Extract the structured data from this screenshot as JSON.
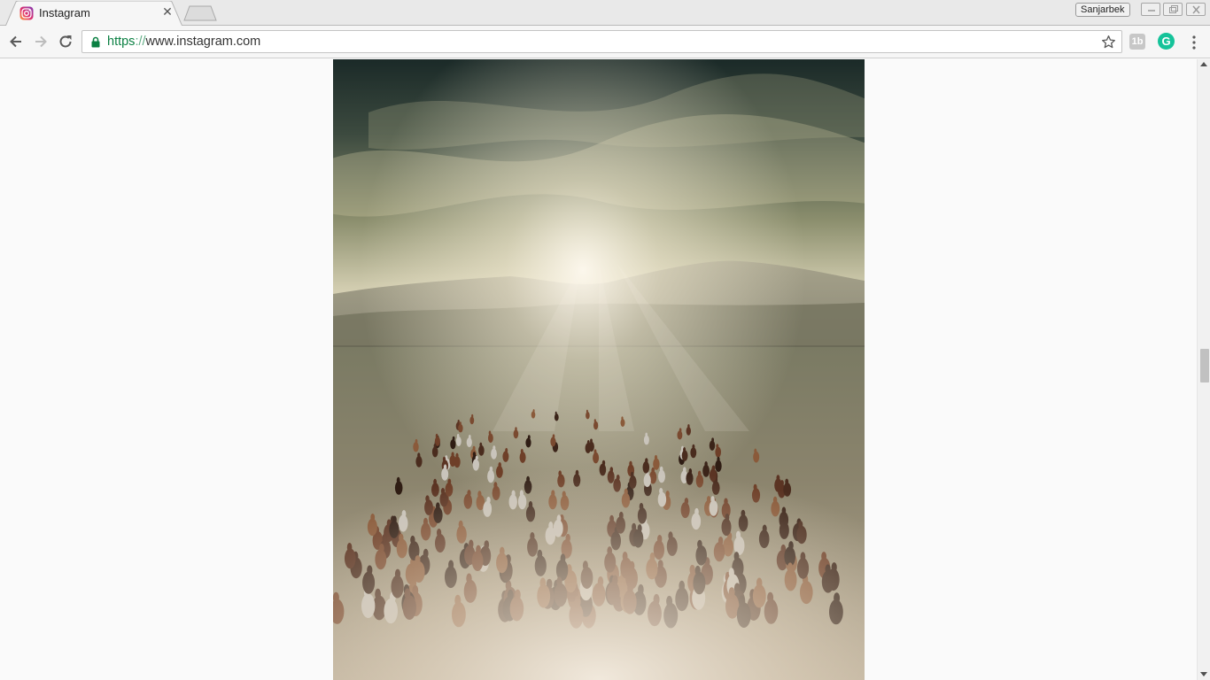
{
  "browser": {
    "tab": {
      "title": "Instagram",
      "favicon": "instagram-icon",
      "close_icon": "close-icon"
    },
    "profile_name": "Sanjarbek",
    "address": {
      "scheme": "https",
      "separator": "://",
      "host": "www.instagram.com",
      "secure_icon": "lock-icon"
    },
    "extensions": [
      {
        "name": "1b-extension-icon",
        "label": "1b"
      },
      {
        "name": "grammarly-icon",
        "label": "G"
      }
    ]
  },
  "page": {
    "post_image": {
      "subject": "herd-of-horses-photo"
    }
  },
  "colors": {
    "secure_green": "#0b8043",
    "grammarly_green": "#15c39a",
    "page_bg": "#fafafa"
  }
}
